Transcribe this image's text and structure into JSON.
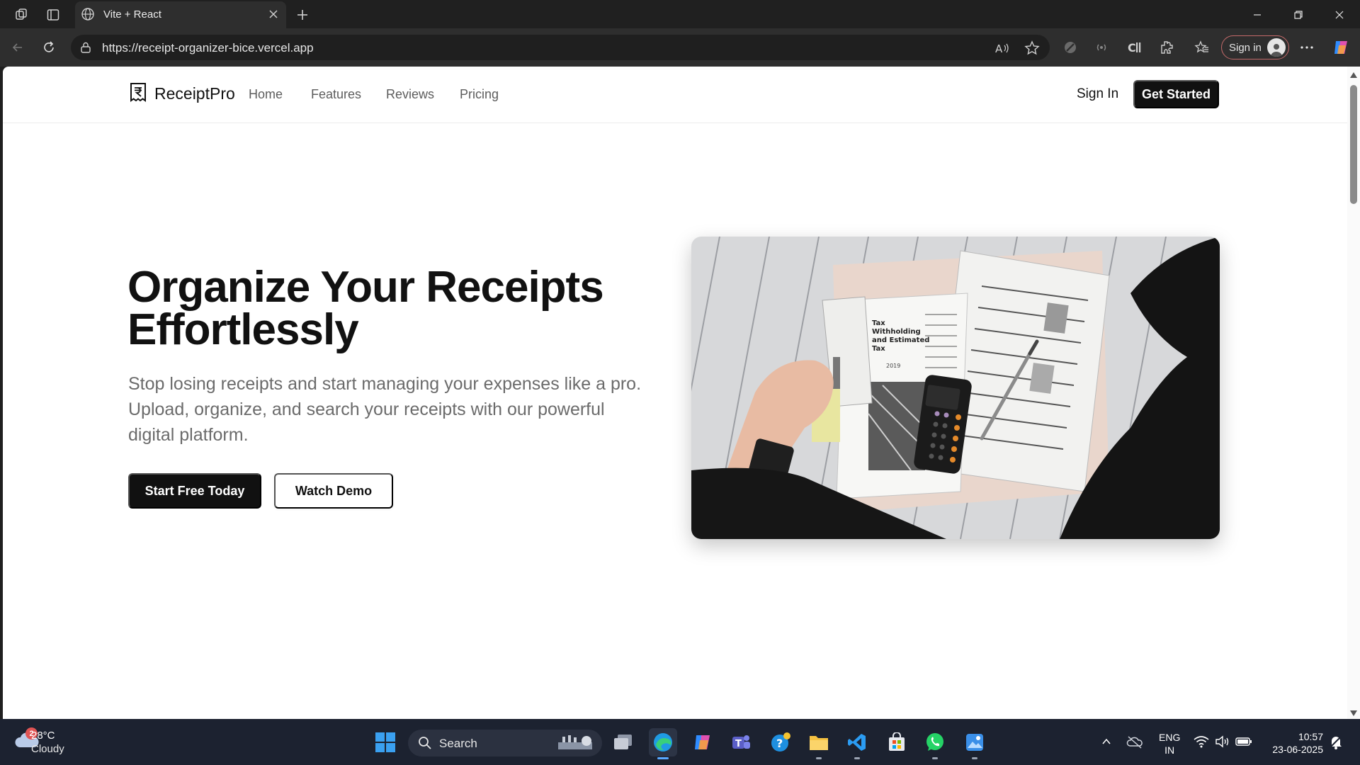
{
  "browser": {
    "tab_title": "Vite + React",
    "url": "https://receipt-organizer-bice.vercel.app",
    "signin_label": "Sign in",
    "icons": [
      "workspaces-icon",
      "vertical-tabs-icon",
      "globe-icon",
      "close-icon",
      "new-tab-icon",
      "minimize-icon",
      "restore-icon",
      "window-close-icon",
      "back-icon",
      "refresh-icon",
      "site-info-icon",
      "read-aloud-icon",
      "favorite-icon",
      "extension-icons",
      "favorites-icon",
      "more-icon",
      "copilot-icon"
    ]
  },
  "site": {
    "brand": "ReceiptPro",
    "brand_icon": "receipt-rupee-icon",
    "nav": {
      "home": "Home",
      "features": "Features",
      "reviews": "Reviews",
      "pricing": "Pricing"
    },
    "sign_in": "Sign In",
    "get_started": "Get Started"
  },
  "hero": {
    "title_line1": "Organize Your Receipts",
    "title_line2": "Effortlessly",
    "subtitle": "Stop losing receipts and start managing your expenses like a pro. Upload, organize, and search your receipts with our powerful digital platform.",
    "cta_primary": "Start Free Today",
    "cta_secondary": "Watch Demo",
    "image_doc_title_1": "Tax",
    "image_doc_title_2": "Withholding",
    "image_doc_title_3": "and Estimated",
    "image_doc_title_4": "Tax",
    "image_doc_year": "2019"
  },
  "taskbar": {
    "weather_badge": "2",
    "temperature": "28°C",
    "condition": "Cloudy",
    "search_placeholder": "Search",
    "language_line1": "ENG",
    "language_line2": "IN",
    "time": "10:57",
    "date": "23-06-2025"
  },
  "colors": {
    "primary_button": "#111111",
    "chrome_bg": "#202020",
    "taskbar_bg": "#1c2230"
  }
}
